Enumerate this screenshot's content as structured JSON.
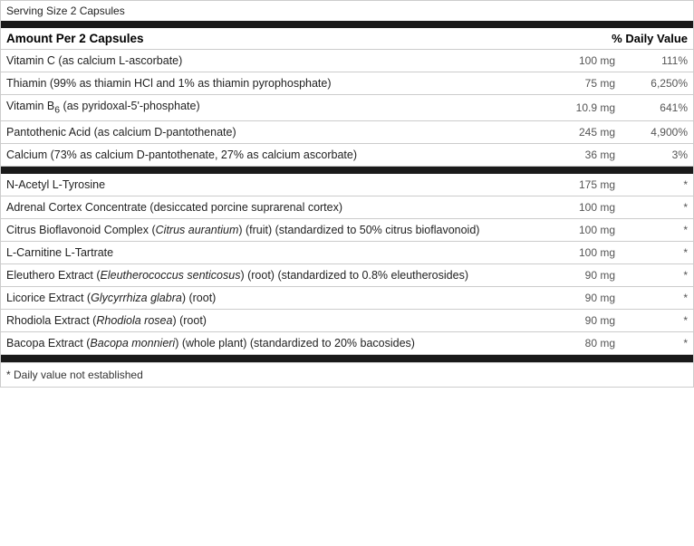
{
  "label": {
    "serving_size": "Serving Size 2 Capsules",
    "amount_header": {
      "left": "Amount Per 2 Capsules",
      "right": "% Daily Value"
    },
    "vitamins_minerals": [
      {
        "name": "Vitamin C (as calcium L-ascorbate)",
        "amount": "100 mg",
        "dv": "111%"
      },
      {
        "name": "Thiamin (99% as thiamin HCl and 1% as thiamin pyrophosphate)",
        "amount": "75 mg",
        "dv": "6,250%"
      },
      {
        "name_prefix": "Vitamin B",
        "name_sub": "6",
        "name_suffix": " (as pyridoxal-5'-phosphate)",
        "amount": "10.9 mg",
        "dv": "641%"
      },
      {
        "name": "Pantothenic Acid (as calcium D-pantothenate)",
        "amount": "245 mg",
        "dv": "4,900%"
      },
      {
        "name": "Calcium (73% as calcium D-pantothenate, 27% as calcium ascorbate)",
        "amount": "36 mg",
        "dv": "3%"
      }
    ],
    "other_ingredients": [
      {
        "name": "N-Acetyl L-Tyrosine",
        "amount": "175 mg",
        "dv": "*"
      },
      {
        "name": "Adrenal Cortex Concentrate (desiccated porcine suprarenal cortex)",
        "amount": "100 mg",
        "dv": "*"
      },
      {
        "name_prefix": "Citrus Bioflavonoid Complex (",
        "name_italic": "Citrus aurantium",
        "name_suffix": ") (fruit) (standardized to 50% citrus bioflavonoid)",
        "amount": "100 mg",
        "dv": "*"
      },
      {
        "name": "L-Carnitine L-Tartrate",
        "amount": "100 mg",
        "dv": "*"
      },
      {
        "name_prefix": "Eleuthero Extract (",
        "name_italic": "Eleutherococcus senticosus",
        "name_suffix": ") (root) (standardized to 0.8% eleutherosides)",
        "amount": "90 mg",
        "dv": "*"
      },
      {
        "name_prefix": "Licorice Extract (",
        "name_italic": "Glycyrrhiza glabra",
        "name_suffix": ") (root)",
        "amount": "90 mg",
        "dv": "*"
      },
      {
        "name_prefix": "Rhodiola Extract (",
        "name_italic": "Rhodiola rosea",
        "name_suffix": ") (root)",
        "amount": "90 mg",
        "dv": "*"
      },
      {
        "name_prefix": "Bacopa Extract (",
        "name_italic": "Bacopa monnieri",
        "name_suffix": ") (whole plant) (standardized to 20% bacosides)",
        "amount": "80 mg",
        "dv": "*"
      }
    ],
    "footnote": "* Daily value not established"
  }
}
